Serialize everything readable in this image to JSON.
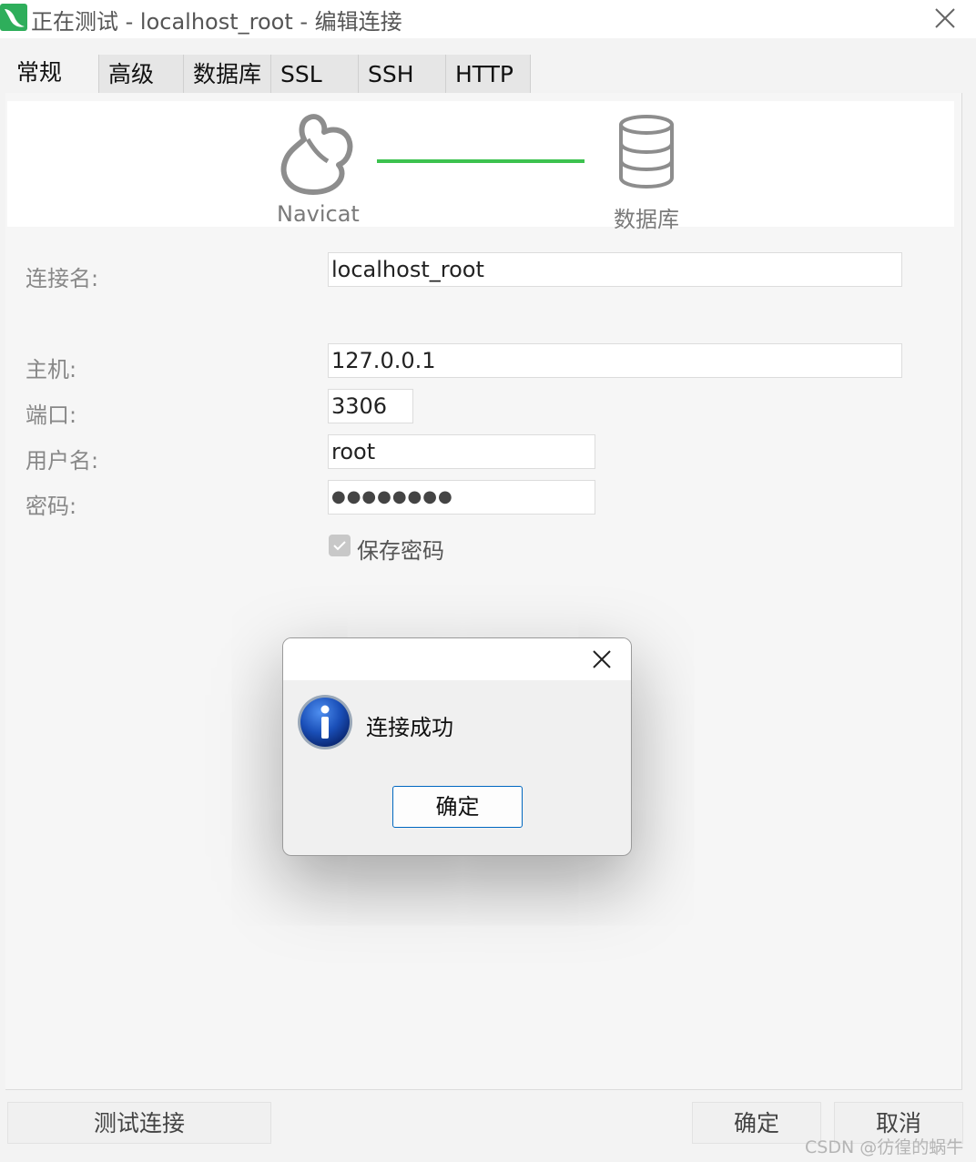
{
  "window": {
    "title": "正在测试 - localhost_root - 编辑连接",
    "icons": {
      "app": "navicat-dolphin-icon",
      "close": "close-icon"
    }
  },
  "tabs": [
    {
      "label": "常规",
      "active": true
    },
    {
      "label": "高级",
      "active": false
    },
    {
      "label": "数据库",
      "active": false
    },
    {
      "label": "SSL",
      "active": false
    },
    {
      "label": "SSH",
      "active": false
    },
    {
      "label": "HTTP",
      "active": false
    }
  ],
  "diagram": {
    "left_label": "Navicat",
    "right_label": "数据库",
    "line_color": "#3cc24f",
    "icons": {
      "left": "navicat-logo-icon",
      "right": "database-icon"
    }
  },
  "form": {
    "connection_name": {
      "label": "连接名:",
      "value": "localhost_root"
    },
    "host": {
      "label": "主机:",
      "value": "127.0.0.1"
    },
    "port": {
      "label": "端口:",
      "value": "3306"
    },
    "username": {
      "label": "用户名:",
      "value": "root"
    },
    "password": {
      "label": "密码:",
      "value": "●●●●●●●●"
    },
    "save_password": {
      "label": "保存密码",
      "checked": true
    }
  },
  "dialog": {
    "message": "连接成功",
    "ok_label": "确定",
    "icons": {
      "info": "info-icon",
      "close": "close-icon"
    }
  },
  "footer": {
    "test_label": "测试连接",
    "ok_label": "确定",
    "cancel_label": "取消"
  },
  "watermark": "CSDN @彷徨的蜗牛"
}
